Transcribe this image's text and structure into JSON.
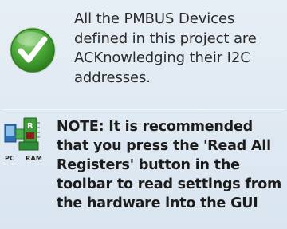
{
  "status": {
    "icon": "green-checkmark-icon",
    "message": "All the PMBUS Devices defined in this project are ACKnowledging their I2C addresses."
  },
  "note": {
    "icon": "pc-ram-transfer-icon",
    "icon_label_pc": "PC",
    "icon_label_ram": "RAM",
    "text": "NOTE: It is recommended that you press the 'Read All Registers' button in the toolbar to read settings from the hardware into the GUI"
  },
  "colors": {
    "panel_background": "#dde8f2",
    "check_green": "#3e9a2e",
    "chip_green": "#3f9b3a"
  }
}
